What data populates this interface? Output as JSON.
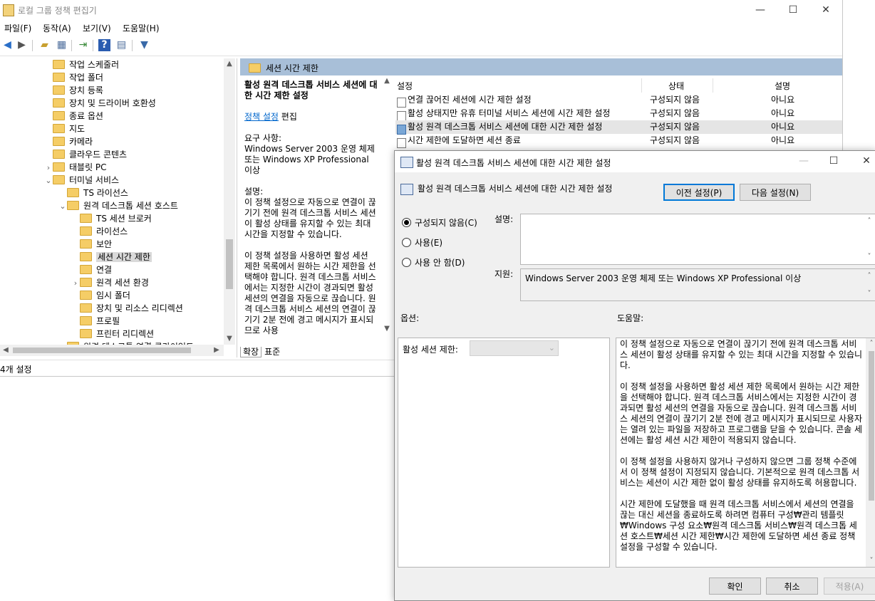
{
  "window": {
    "title": "로컬 그룹 정책 편집기",
    "minimize": "—",
    "maximize": "☐",
    "close": "✕"
  },
  "menu": [
    "파일(F)",
    "동작(A)",
    "보기(V)",
    "도움말(H)"
  ],
  "toolbar_icons": [
    "back-icon",
    "forward-icon",
    "up-folder-icon",
    "show-hide-tree-icon",
    "export-list-icon",
    "help-icon",
    "properties-icon",
    "filter-icon"
  ],
  "tree": [
    {
      "label": "작업 스케줄러",
      "level": 1,
      "expander": ""
    },
    {
      "label": "작업 폴더",
      "level": 1,
      "expander": ""
    },
    {
      "label": "장치 등록",
      "level": 1,
      "expander": ""
    },
    {
      "label": "장치 및 드라이버 호환성",
      "level": 1,
      "expander": ""
    },
    {
      "label": "종료 옵션",
      "level": 1,
      "expander": ""
    },
    {
      "label": "지도",
      "level": 1,
      "expander": ""
    },
    {
      "label": "카메라",
      "level": 1,
      "expander": ""
    },
    {
      "label": "클라우드 콘텐츠",
      "level": 1,
      "expander": ""
    },
    {
      "label": "태블릿 PC",
      "level": 1,
      "expander": "›"
    },
    {
      "label": "터미널 서비스",
      "level": 1,
      "expander": "⌄"
    },
    {
      "label": "TS 라이선스",
      "level": 2,
      "expander": ""
    },
    {
      "label": "원격 데스크톱 세션 호스트",
      "level": 2,
      "expander": "⌄"
    },
    {
      "label": "TS 세션 브로커",
      "level": 3,
      "expander": ""
    },
    {
      "label": "라이선스",
      "level": 3,
      "expander": ""
    },
    {
      "label": "보안",
      "level": 3,
      "expander": ""
    },
    {
      "label": "세션 시간 제한",
      "level": 3,
      "expander": "",
      "selected": true
    },
    {
      "label": "연결",
      "level": 3,
      "expander": ""
    },
    {
      "label": "원격 세션 환경",
      "level": 3,
      "expander": "›"
    },
    {
      "label": "임시 폴더",
      "level": 3,
      "expander": ""
    },
    {
      "label": "장치 및 리소스 리디렉션",
      "level": 3,
      "expander": ""
    },
    {
      "label": "프로필",
      "level": 3,
      "expander": ""
    },
    {
      "label": "프린터 리디렉션",
      "level": 3,
      "expander": ""
    },
    {
      "label": "원격 데스크톱 연결 클라이언트",
      "level": 2,
      "expander": "›"
    }
  ],
  "panel_title": "세션 시간 제한",
  "desc": {
    "heading": "활성 원격 데스크톱 서비스 세션에 대한 시간 제한 설정",
    "policy_link": "정책 설정",
    "edit": " 편집",
    "req_label": "요구 사항:",
    "req_text": "Windows Server 2003 운영 체제 또는 Windows XP Professional 이상",
    "desc_label": "설명:",
    "p1": "이 정책 설정으로 자동으로 연결이 끊기기 전에 원격 데스크톱 서비스 세션이 활성 상태를 유지할 수 있는 최대 시간을 지정할 수 있습니다.",
    "p2": "이 정책 설정을 사용하면 활성 세션 제한 목록에서 원하는 시간 제한을 선택해야 합니다. 원격 데스크톱 서비스에서는 지정한 시간이 경과되면 활성 세션의 연결을 자동으로 끊습니다. 원격 데스크톱 서비스 세션의 연결이 끊기기 2분 전에 경고 메시지가 표시되므로 사용"
  },
  "list": {
    "headers": {
      "setting": "설정",
      "state": "상태",
      "comment": "설명"
    },
    "rows": [
      {
        "name": "연결 끊어진 세션에 시간 제한 설정",
        "state": "구성되지 않음",
        "comment": "아니요"
      },
      {
        "name": "활성 상태지만 유휴 터미널 서비스 세션에 시간 제한 설정",
        "state": "구성되지 않음",
        "comment": "아니요"
      },
      {
        "name": "활성 원격 데스크톱 서비스 세션에 대한 시간 제한 설정",
        "state": "구성되지 않음",
        "comment": "아니요",
        "highlight": true
      },
      {
        "name": "시간 제한에 도달하면 세션 종료",
        "state": "구성되지 않음",
        "comment": "아니요"
      }
    ]
  },
  "tabs": [
    "확장",
    "표준"
  ],
  "status": "4개 설정",
  "dialog": {
    "title": "활성 원격 데스크톱 서비스 세션에 대한 시간 제한 설정",
    "setting_name": "활성 원격 데스크톱 서비스 세션에 대한 시간 제한 설정",
    "prev_btn": "이전 설정(P)",
    "next_btn": "다음 설정(N)",
    "radio_not_configured": "구성되지 않음(C)",
    "radio_enabled": "사용(E)",
    "radio_disabled": "사용 안 함(D)",
    "comment_label": "설명:",
    "supported_label": "지원:",
    "supported_text": "Windows Server 2003 운영 체제 또는 Windows XP Professional 이상",
    "options_label": "옵션:",
    "help_label": "도움말:",
    "option_session_limit": "활성 세션 제한:",
    "help_p1": "이 정책 설정으로 자동으로 연결이 끊기기 전에 원격 데스크톱 서비스 세션이 활성 상태를 유지할 수 있는 최대 시간을 지정할 수 있습니다.",
    "help_p2": "이 정책 설정을 사용하면 활성 세션 제한 목록에서 원하는 시간 제한을 선택해야 합니다. 원격 데스크톱 서비스에서는 지정한 시간이 경과되면 활성 세션의 연결을 자동으로 끊습니다. 원격 데스크톱 서비스 세션의 연결이 끊기기 2분 전에 경고 메시지가 표시되므로 사용자는 열려 있는 파일을 저장하고 프로그램을 닫을 수 있습니다. 콘솔 세션에는 활성 세션 시간 제한이 적용되지 않습니다.",
    "help_p3": "이 정책 설정을 사용하지 않거나 구성하지 않으면 그룹 정책 수준에서 이 정책 설정이 지정되지 않습니다. 기본적으로 원격 데스크톱 서비스는 세션이 시간 제한 없이 활성 상태를 유지하도록 허용합니다.",
    "help_p4": "시간 제한에 도달했을 때 원격 데스크톱 서비스에서 세션의 연결을 끊는 대신 세션을 종료하도록 하려면 컴퓨터 구성₩관리 템플릿₩Windows 구성 요소₩원격 데스크톱 서비스₩원격 데스크톱 세션 호스트₩세션 시간 제한₩시간 제한에 도달하면 세션 종료 정책 설정을 구성할 수 있습니다.",
    "ok": "확인",
    "cancel": "취소",
    "apply": "적용(A)"
  }
}
